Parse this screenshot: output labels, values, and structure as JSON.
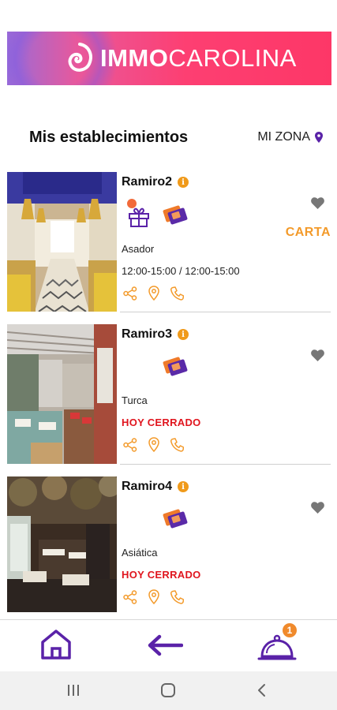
{
  "banner": {
    "brand_bold": "IMMO",
    "brand_regular": "CAROLINA"
  },
  "header": {
    "title": "Mis establecimientos",
    "zone_label": "MI ZONA"
  },
  "establishments": [
    {
      "name": "Ramiro2",
      "category": "Asador",
      "hours": "12:00-15:00 / 12:00-15:00",
      "status": "",
      "carta_label": "CARTA",
      "has_gift": true
    },
    {
      "name": "Ramiro3",
      "category": "Turca",
      "hours": "",
      "status": "HOY CERRADO",
      "carta_label": "",
      "has_gift": false
    },
    {
      "name": "Ramiro4",
      "category": "Asiática",
      "hours": "",
      "status": "HOY CERRADO",
      "carta_label": "",
      "has_gift": false
    }
  ],
  "bottom_nav": {
    "orders_badge": "1"
  },
  "colors": {
    "accent_purple": "#5a22a8",
    "accent_orange": "#f39a2a",
    "closed_red": "#e0151e",
    "banner_pink": "#fd3f72"
  },
  "icons": [
    "info-icon",
    "heart-icon",
    "gift-icon",
    "tickets-icon",
    "share-icon",
    "map-pin-icon",
    "phone-icon",
    "home-icon",
    "back-arrow-icon",
    "cloche-icon"
  ]
}
